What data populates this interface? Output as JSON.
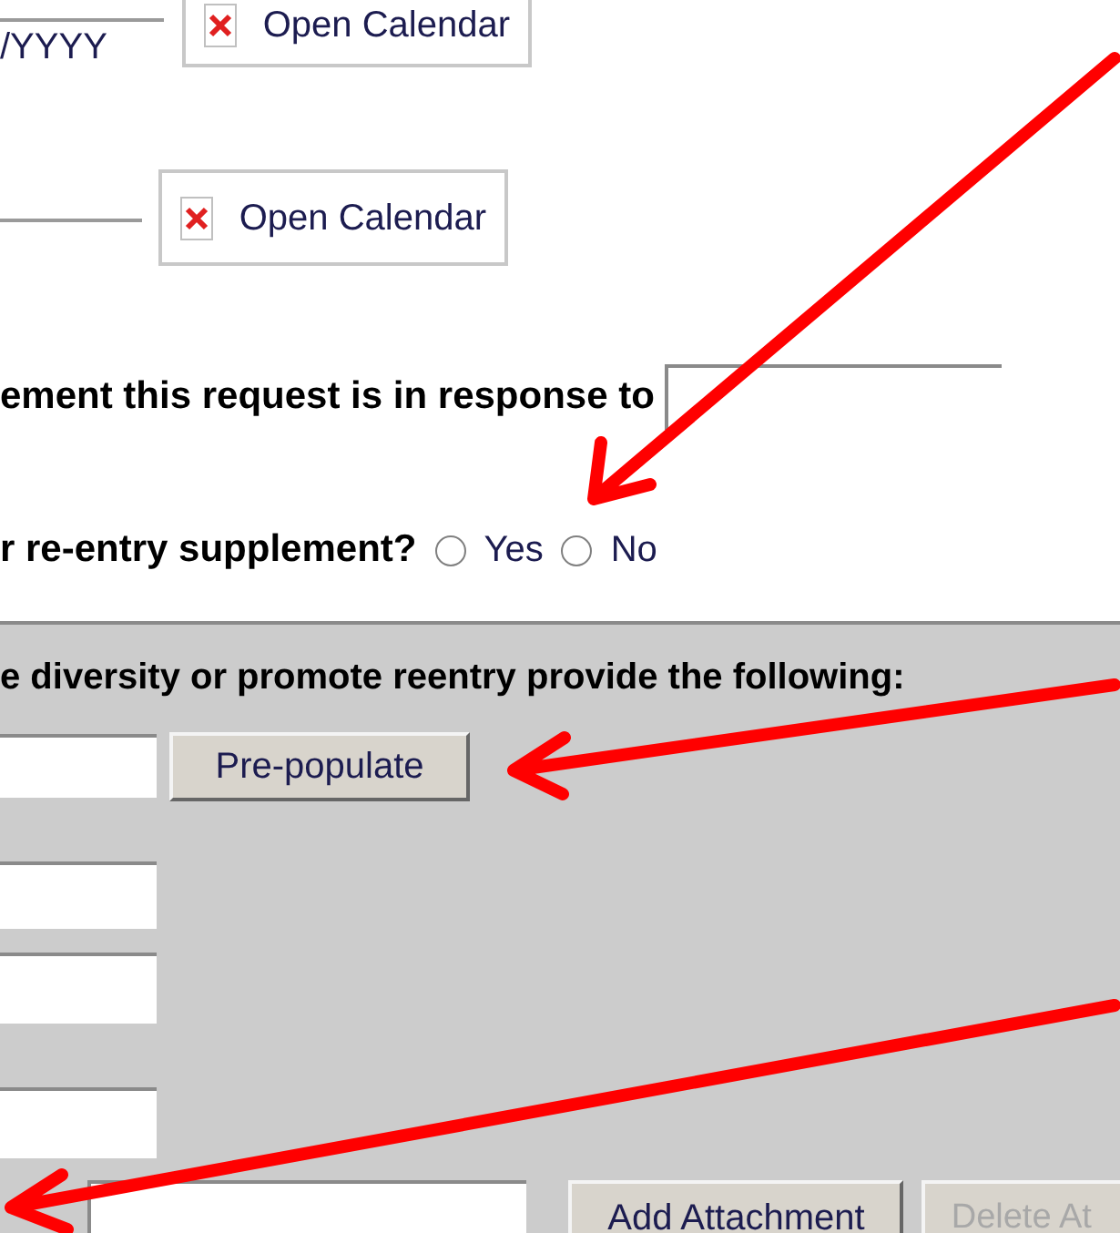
{
  "date_fields": [
    {
      "hint": "/YYYY",
      "button": "Open Calendar"
    },
    {
      "button": "Open Calendar"
    }
  ],
  "announcement": {
    "label": "ement this request is in response to"
  },
  "supplement": {
    "label": "r re-entry supplement?",
    "options": [
      {
        "label": "Yes",
        "selected": false
      },
      {
        "label": "No",
        "selected": false
      }
    ]
  },
  "diversity_section": {
    "heading": "e diversity or promote reentry provide the following:",
    "prepopulate_button": "Pre-populate"
  },
  "attachment": {
    "add_button": "Add Attachment",
    "delete_button": {
      "label": "Delete At",
      "disabled": true
    }
  }
}
